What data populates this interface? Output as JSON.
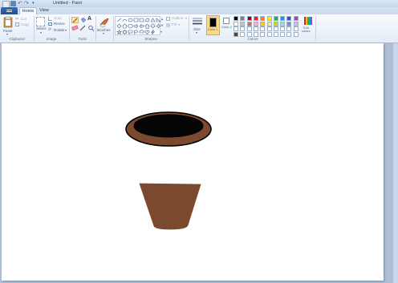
{
  "window": {
    "title": "Untitled - Paint"
  },
  "tabs": [
    {
      "label": "Home"
    },
    {
      "label": "View"
    }
  ],
  "clipboard": {
    "paste_label": "Paste",
    "cut_label": "Cut",
    "copy_label": "Copy",
    "group_label": "Clipboard"
  },
  "image": {
    "select_label": "Select",
    "crop_label": "Crop",
    "resize_label": "Resize",
    "rotate_label": "Rotate",
    "group_label": "Image"
  },
  "tools": {
    "group_label": "Tools",
    "text_glyph": "A"
  },
  "brushes": {
    "label": "Brushes"
  },
  "shapes": {
    "group_label": "Shapes",
    "outline_label": "Outline",
    "fill_label": "Fill",
    "icons": [
      "line",
      "curve",
      "oval",
      "rectangle",
      "rounded-rectangle",
      "polygon",
      "triangle",
      "right-triangle",
      "diamond",
      "pentagon",
      "hexagon",
      "right-arrow",
      "left-arrow",
      "up-arrow",
      "down-arrow",
      "four-point-star",
      "five-point-star",
      "six-point-star",
      "rounded-callout",
      "oval-callout",
      "cloud-callout",
      "heart",
      "lightning"
    ]
  },
  "size": {
    "label": "Size"
  },
  "colors": {
    "group_label": "Colors",
    "color1_label": "Color 1",
    "color2_label": "Color 2",
    "color1": "#000000",
    "color2": "#ffffff",
    "edit_label_1": "Edit",
    "edit_label_2": "colors",
    "palette_row1": [
      "#000000",
      "#7f7f7f",
      "#880015",
      "#ed1c24",
      "#ff7f27",
      "#fff200",
      "#22b14c",
      "#00a2e8",
      "#3f48cc",
      "#a349a4"
    ],
    "palette_row2": [
      "#ffffff",
      "#c3c3c3",
      "#b97a57",
      "#ffaec9",
      "#ffc90e",
      "#efe4b0",
      "#b5e61d",
      "#99d9ea",
      "#7092be",
      "#c8bfe7"
    ],
    "palette_row3": [
      "#ffffff",
      "#ffffff",
      "#ffffff",
      "#ffffff",
      "#ffffff",
      "#ffffff",
      "#ffffff",
      "#ffffff",
      "#ffffff",
      "#ffffff"
    ],
    "palette_row4": [
      "#6b3d1e",
      "#ffffff",
      "#ffffff",
      "#ffffff",
      "#ffffff",
      "#ffffff",
      "#ffffff",
      "#ffffff",
      "#ffffff",
      "#ffffff"
    ]
  },
  "drawing": {
    "subject": "flower pot",
    "pot_color": "#7b4a2e",
    "rim_color": "#7b4a2e",
    "opening_color": "#050505",
    "outline_color": "#000000"
  }
}
